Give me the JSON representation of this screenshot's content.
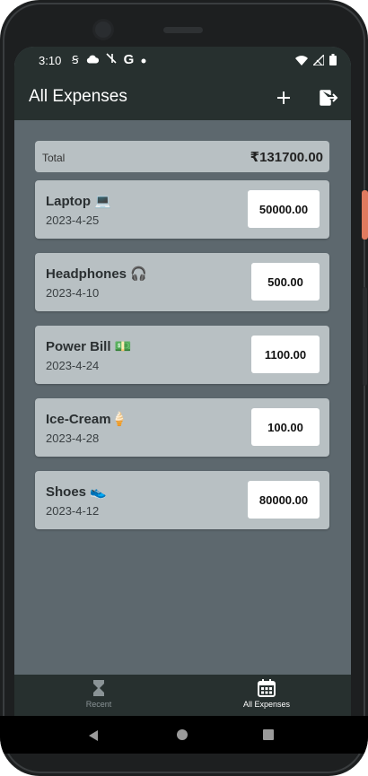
{
  "status": {
    "time": "3:10",
    "left_icons": [
      "security-s-icon",
      "cloud-icon",
      "signal-slash-icon",
      "google-g-icon",
      "dot-icon"
    ],
    "right_icons": [
      "wifi-icon",
      "cellular-icon",
      "battery-icon"
    ]
  },
  "appbar": {
    "title": "All Expenses",
    "add_icon": "plus-icon",
    "logout_icon": "logout-icon"
  },
  "total": {
    "label": "Total",
    "value": "₹131700.00"
  },
  "expenses": [
    {
      "name": "Laptop 💻",
      "date": "2023-4-25",
      "amount": "50000.00"
    },
    {
      "name": "Headphones 🎧",
      "date": "2023-4-10",
      "amount": "500.00"
    },
    {
      "name": "Power Bill 💵",
      "date": "2023-4-24",
      "amount": "1100.00"
    },
    {
      "name": "Ice-Cream🍦",
      "date": "2023-4-28",
      "amount": "100.00"
    },
    {
      "name": "Shoes 👟",
      "date": "2023-4-12",
      "amount": "80000.00"
    }
  ],
  "nav": {
    "recent_label": "Recent",
    "all_label": "All Expenses",
    "recent_icon": "hourglass-icon",
    "all_icon": "calendar-icon"
  },
  "colors": {
    "app_bar": "#27302f",
    "background": "#5d686e",
    "card": "#b8c0c3",
    "nav_inactive": "#8a9396",
    "nav_active": "#ffffff"
  }
}
